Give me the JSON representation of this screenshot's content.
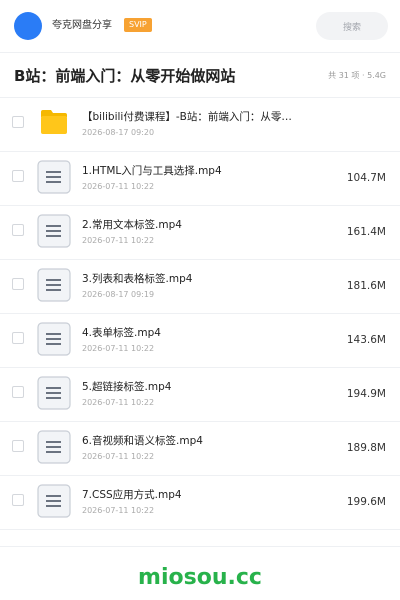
{
  "header": {
    "site_name": "夸克网盘分享",
    "badge": "SVIP",
    "search_placeholder": "搜索",
    "accent_color": "#2a7cf6"
  },
  "title_bar": {
    "title": "B站：前端入门：从零开始做网站",
    "summary": "共 31 项 · 5.4G"
  },
  "files": [
    {
      "type": "folder",
      "icon": "folder-icon",
      "name": "【bilibili付费课程】-B站：前端入门：从零…",
      "date": "2026-08-17 09:20",
      "size": ""
    },
    {
      "type": "video",
      "icon": "document-icon",
      "name": "1.HTML入门与工具选择.mp4",
      "date": "2026-07-11 10:22",
      "size": "104.7M"
    },
    {
      "type": "video",
      "icon": "document-icon",
      "name": "2.常用文本标签.mp4",
      "date": "2026-07-11 10:22",
      "size": "161.4M"
    },
    {
      "type": "video",
      "icon": "document-icon",
      "name": "3.列表和表格标签.mp4",
      "date": "2026-08-17 09:19",
      "size": "181.6M"
    },
    {
      "type": "video",
      "icon": "document-icon",
      "name": "4.表单标签.mp4",
      "date": "2026-07-11 10:22",
      "size": "143.6M"
    },
    {
      "type": "video",
      "icon": "document-icon",
      "name": "5.超链接标签.mp4",
      "date": "2026-07-11 10:22",
      "size": "194.9M"
    },
    {
      "type": "video",
      "icon": "document-icon",
      "name": "6.音视频和语义标签.mp4",
      "date": "2026-07-11 10:22",
      "size": "189.8M"
    },
    {
      "type": "video",
      "icon": "document-icon",
      "name": "7.CSS应用方式.mp4",
      "date": "2026-07-11 10:22",
      "size": "199.6M"
    }
  ],
  "footer": {
    "brand": "miosou.cc",
    "brand_color": "#28b24b"
  }
}
